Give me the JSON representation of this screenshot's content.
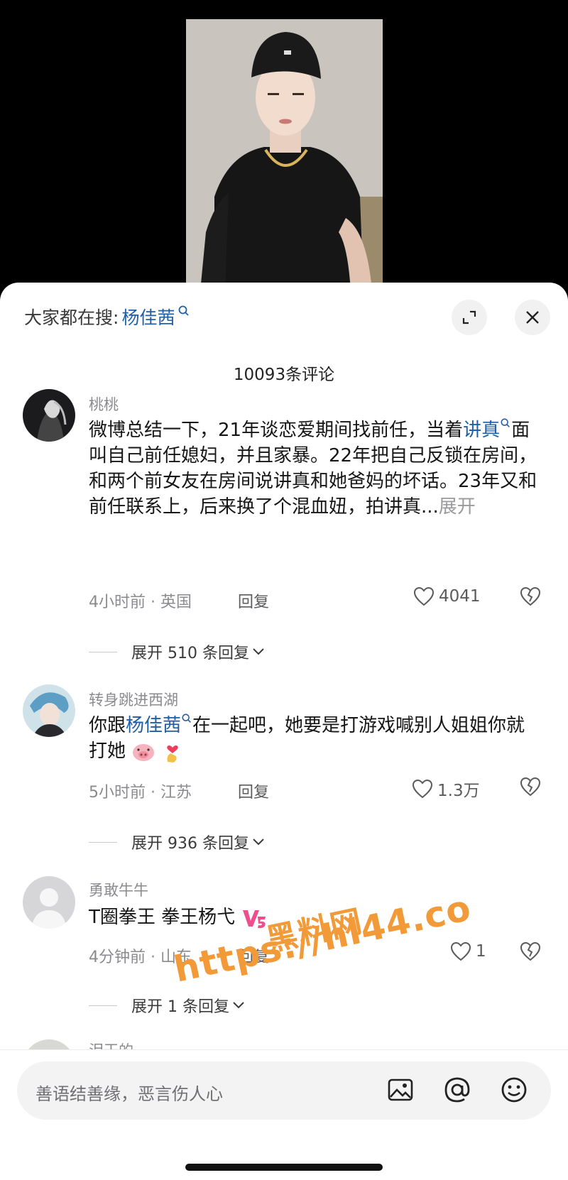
{
  "search": {
    "prefix": "大家都在搜:",
    "term": "杨佳茜"
  },
  "header": {
    "count_title": "10093条评论"
  },
  "comments": [
    {
      "username": "桃桃",
      "text_parts": [
        {
          "text": "微博总结一下，21年谈恋爱期间找前任，当着",
          "link": false
        },
        {
          "text": "讲真",
          "link": true
        },
        {
          "text": "面叫自己前任媳妇，并且家暴。22年把自己反锁在房间，和两个前女友在房间说讲真和她爸妈的坏话。23年又和前任联系上，后来换了个混血妞，拍讲真...",
          "link": false
        }
      ],
      "more_label": "展开",
      "meta": "4小时前 · 英国",
      "reply_label": "回复",
      "likes": "4041",
      "expand_label": "展开 510 条回复"
    },
    {
      "username": "转身跳进西湖",
      "text_parts": [
        {
          "text": "你跟",
          "link": false
        },
        {
          "text": "杨佳茜",
          "link": true
        },
        {
          "text": "在一起吧，她要是打游戏喊别人姐姐你就打她",
          "link": false
        }
      ],
      "meta": "5小时前 · 江苏",
      "reply_label": "回复",
      "likes": "1.3万",
      "expand_label": "展开 936 条回复"
    },
    {
      "username": "勇敢牛牛",
      "text_parts": [
        {
          "text": "T圈拳王 拳王杨弋",
          "link": false
        }
      ],
      "meta": "4分钟前 · 山东",
      "reply_label": "回复",
      "likes": "1",
      "expand_label": "展开 1 条回复"
    }
  ],
  "partial_username": "泪干的",
  "watermark": {
    "line1": "黑料网",
    "line2": "https://hl44.co"
  },
  "input": {
    "placeholder": "善语结善缘，恶言伤人心"
  },
  "colors": {
    "link": "#1f5fa8",
    "watermark": "#f29a38"
  }
}
